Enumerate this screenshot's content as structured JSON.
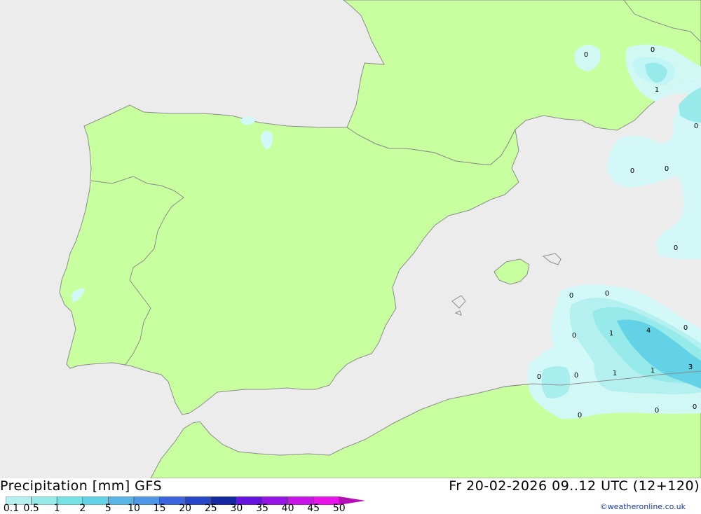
{
  "header": {
    "product": "Precipitation [mm] GFS",
    "valid_time": "Fr 20-02-2026 09..12 UTC (12+120)"
  },
  "legend": {
    "levels": [
      "0.1",
      "0.5",
      "1",
      "2",
      "5",
      "10",
      "15",
      "20",
      "25",
      "30",
      "35",
      "40",
      "45",
      "50"
    ],
    "colors": [
      "#b4f0f0",
      "#96eaea",
      "#78e1e6",
      "#64d2e6",
      "#5ab4e6",
      "#5096e6",
      "#3c64dc",
      "#2846c8",
      "#1428a0",
      "#6414dc",
      "#9614e6",
      "#c814e6",
      "#e614e6",
      "#b40fb4"
    ]
  },
  "credit": "©weatheronline.co.uk",
  "map": {
    "sea_color": "#ececec",
    "land_color": "#c8ff9f",
    "contour_labels": [
      "0",
      "0",
      "1",
      "0",
      "0",
      "0",
      "0",
      "0",
      "0",
      "0",
      "0",
      "1",
      "4",
      "0",
      "0",
      "1",
      "1",
      "3",
      "0",
      "0",
      "0",
      "0"
    ]
  }
}
